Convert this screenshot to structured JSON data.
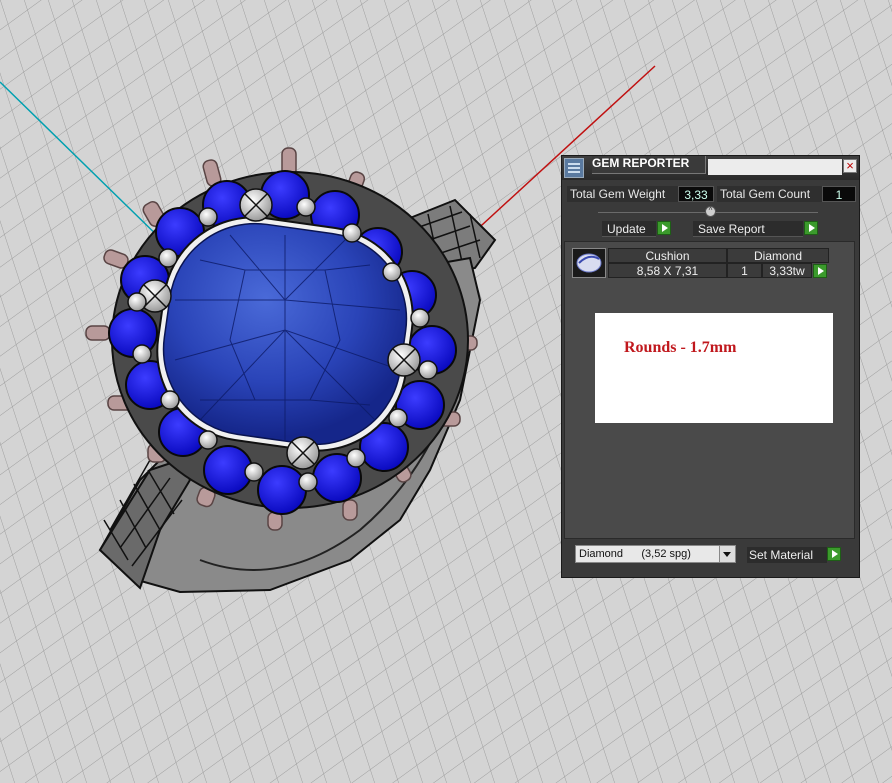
{
  "viewport": {
    "name": "3D viewport - cushion halo ring"
  },
  "gem_reporter": {
    "title": "GEM REPORTER",
    "close_label": "×",
    "total_weight_label": "Total Gem Weight",
    "total_weight_value": "3,33",
    "total_count_label": "Total Gem Count",
    "total_count_value": "1",
    "update_label": "Update",
    "save_report_label": "Save Report",
    "table": {
      "shape": "Cushion",
      "material": "Diamond",
      "size": "8,58 X 7,31",
      "count": "1",
      "weight": "3,33tw"
    },
    "note": "Rounds - 1.7mm",
    "material_select": "Diamond      (3,52 spg)",
    "set_material_label": "Set Material"
  },
  "colors": {
    "viewport_bg": "#d4d4d4",
    "sapphire": "#1414d8",
    "metal": "#7a7a7a",
    "prongs": "#b89a9a",
    "axis_x": "#c01010",
    "axis_y": "#00a0b0",
    "note_text": "#c0181d",
    "play_button": "#3b9a2c"
  },
  "icons": [
    "gem-reporter-app-icon",
    "close-icon",
    "play-arrow-icon",
    "collapse-knob-icon",
    "cushion-gem-icon",
    "dropdown-arrow-icon"
  ]
}
